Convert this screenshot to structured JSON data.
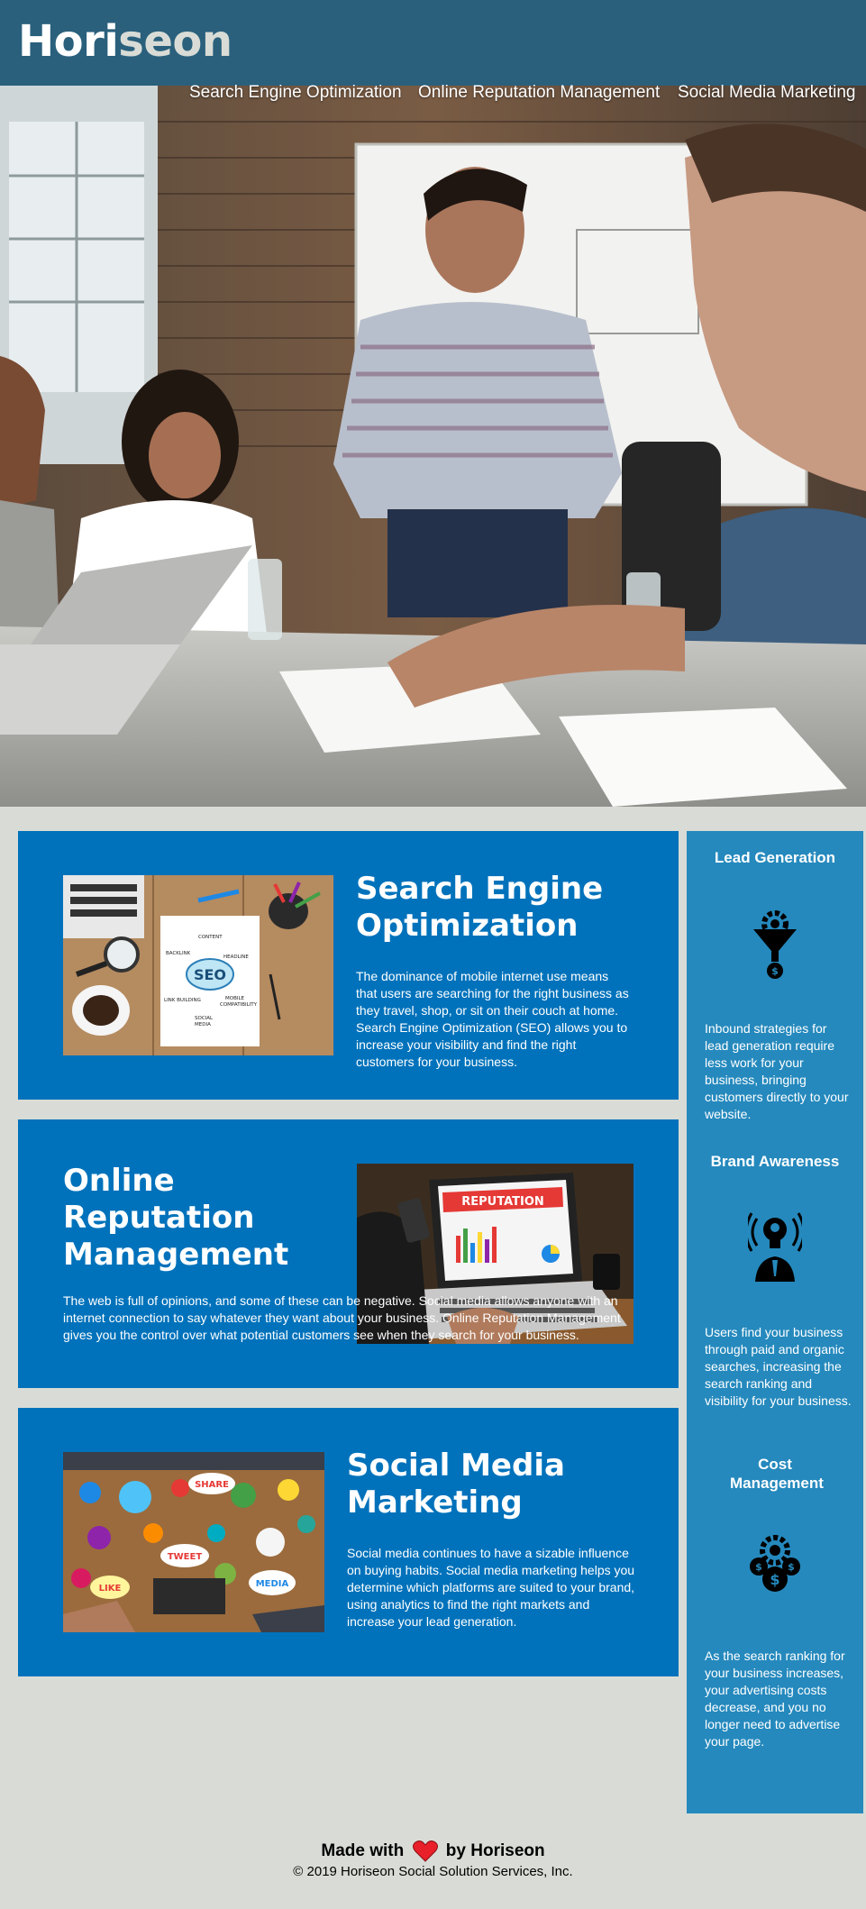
{
  "header": {
    "logo_main": "Hori",
    "logo_accent": "seon",
    "nav": [
      {
        "label": "Search Engine Optimization"
      },
      {
        "label": "Online Reputation Management"
      },
      {
        "label": "Social Media Marketing"
      }
    ]
  },
  "content": [
    {
      "title": "Search Engine Optimization",
      "text": "The dominance of mobile internet use means that users are searching for the right business as they travel, shop, or sit on their couch at home. Search Engine Optimization (SEO) allows you to increase your visibility and find the right customers for your business.",
      "image_text": {
        "bubble": "SEO",
        "labels": [
          "CONTENT",
          "BACKLINK",
          "HEADLINE",
          "LINK BUILDING",
          "MOBILE",
          "COMPATIBILITY",
          "SOCIAL",
          "MEDIA"
        ]
      }
    },
    {
      "title": "Online Reputation Management",
      "text": "The web is full of opinions, and some of these can be negative. Social media allows anyone with an internet connection to say whatever they want about your business. Online Reputation Management gives you the control over what potential customers see when they search for your business.",
      "image_text": {
        "banner": "REPUTATION"
      }
    },
    {
      "title": "Social Media Marketing",
      "text": "Social media continues to have a sizable influence on buying habits. Social media marketing helps you determine which platforms are suited to your brand, using analytics to find the right markets and increase your lead generation.",
      "image_text": {
        "bubbles": [
          "SHARE",
          "TWEET",
          "LIKE",
          "MEDIA"
        ]
      }
    }
  ],
  "benefits": [
    {
      "title": "Lead Generation",
      "icon": "lead-funnel-icon",
      "text": "Inbound strategies for lead generation require less work for your business, bringing customers directly to your website."
    },
    {
      "title": "Brand Awareness",
      "icon": "lightbulb-head-icon",
      "text": "Users find your business through paid and organic searches, increasing the search ranking and visibility for your business."
    },
    {
      "title": "Cost Management",
      "icon": "coins-gear-icon",
      "text": "As the search ranking for your business increases, your advertising costs decrease, and you no longer need to advertise your page."
    }
  ],
  "footer": {
    "made_prefix": "Made with",
    "made_suffix": "by Horiseon",
    "copyright": "© 2019 Horiseon Social Solution Services, Inc."
  },
  "colors": {
    "header_bg": "#2a607c",
    "section_bg": "#0072bb",
    "aside_bg": "#2589bd",
    "page_bg": "#d9dcd6",
    "heart": "#e8202a"
  }
}
